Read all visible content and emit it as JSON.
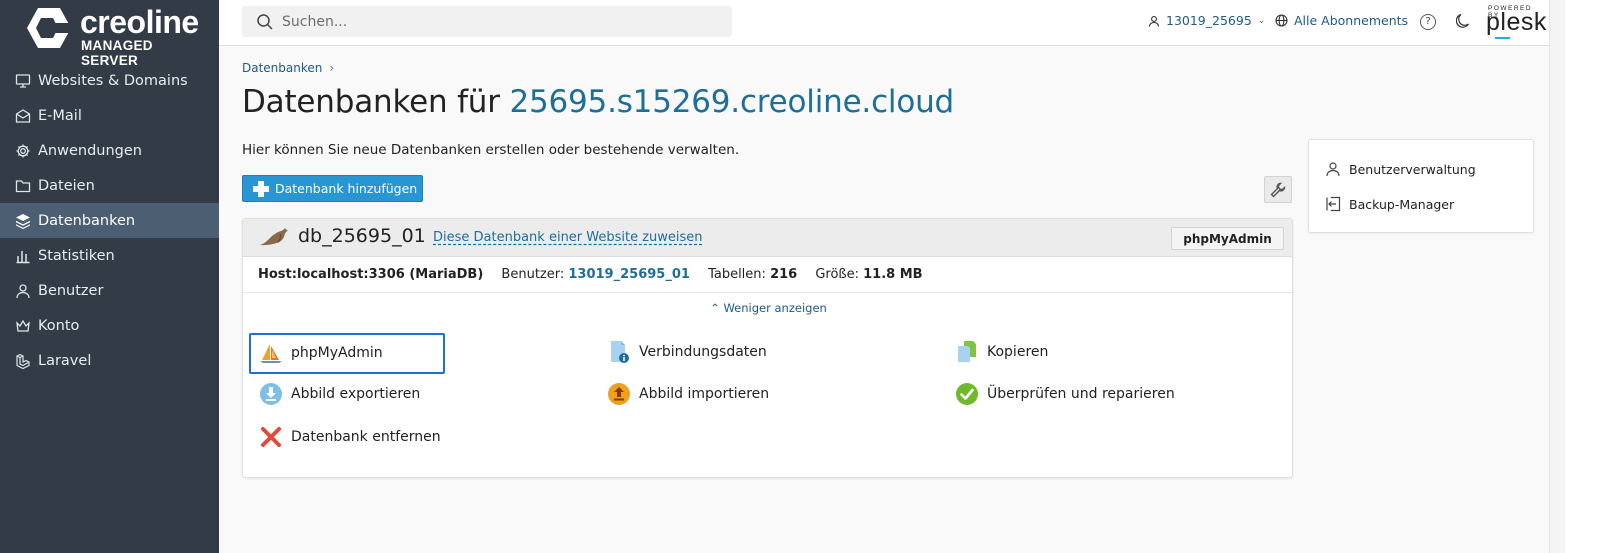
{
  "brand": {
    "name": "creoline",
    "tagline": "MANAGED SERVER"
  },
  "sidebar": {
    "items": [
      {
        "label": "Websites & Domains",
        "icon": "monitor-icon"
      },
      {
        "label": "E-Mail",
        "icon": "mail-icon"
      },
      {
        "label": "Anwendungen",
        "icon": "gear-icon"
      },
      {
        "label": "Dateien",
        "icon": "folder-icon"
      },
      {
        "label": "Datenbanken",
        "icon": "database-icon",
        "active": true
      },
      {
        "label": "Statistiken",
        "icon": "bar-chart-icon"
      },
      {
        "label": "Benutzer",
        "icon": "user-icon"
      },
      {
        "label": "Konto",
        "icon": "crown-icon"
      },
      {
        "label": "Laravel",
        "icon": "laravel-icon"
      }
    ]
  },
  "header": {
    "search_placeholder": "Suchen...",
    "user": "13019_25695",
    "subscriptions": "Alle Abonnements",
    "help": "?",
    "powered_by": "POWERED BY",
    "plesk": "plesk"
  },
  "main": {
    "breadcrumb": "Datenbanken",
    "title_prefix": "Datenbanken für ",
    "title_host": "25695.s15269.creoline.cloud",
    "intro": "Hier können Sie neue Datenbanken erstellen oder bestehende verwalten.",
    "add_button": "Datenbank hinzufügen"
  },
  "database": {
    "name": "db_25695_01",
    "assign_link": "Diese Datenbank einer Website zuweisen",
    "phpmyadmin_button": "phpMyAdmin",
    "host_label": "Host:",
    "host_value": "localhost:3306 (MariaDB)",
    "user_label": "Benutzer:",
    "user_value": "13019_25695_01",
    "tables_label": "Tabellen:",
    "tables_value": "216",
    "size_label": "Größe:",
    "size_value": "11.8 MB",
    "show_less": "Weniger anzeigen",
    "actions": {
      "phpmyadmin": "phpMyAdmin",
      "connection": "Verbindungsdaten",
      "copy": "Kopieren",
      "export": "Abbild exportieren",
      "import": "Abbild importieren",
      "check": "Überprüfen und reparieren",
      "remove": "Datenbank entfernen"
    }
  },
  "side_panel": {
    "user_management": "Benutzerverwaltung",
    "backup_manager": "Backup-Manager"
  },
  "colors": {
    "sidebar_bg": "#323b46",
    "sidebar_active": "#4b5e72",
    "primary_button": "#2896d3",
    "link": "#1f6d99",
    "focus": "#1e6fd9"
  }
}
